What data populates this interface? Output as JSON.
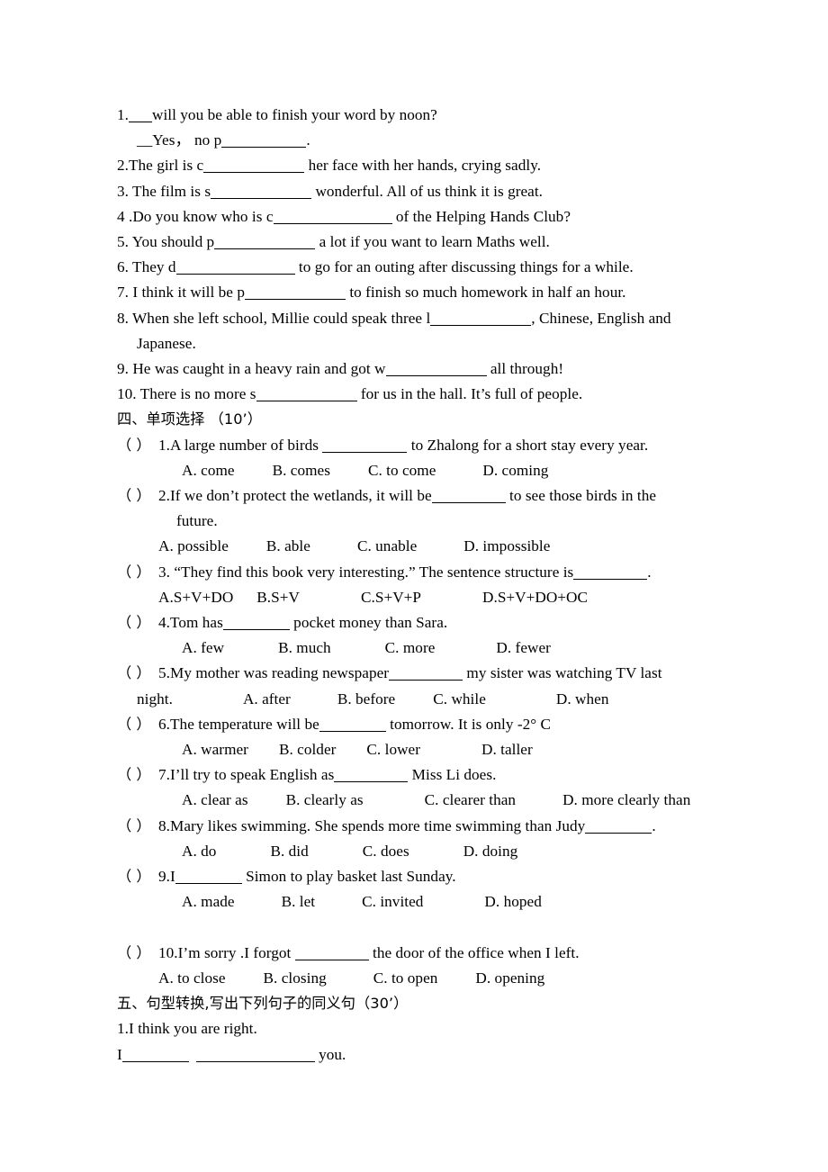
{
  "document": {
    "kind": "english-exam-worksheet-page"
  },
  "word_fill_section": {
    "items": [
      {
        "id": "q1",
        "lines": [
          {
            "pre": "1.",
            "blank": "tiny",
            "post": "will you be able to finish your word by noon?"
          },
          {
            "pre": "__Yes，  no p",
            "blank": "long",
            "post": "."
          }
        ]
      },
      {
        "id": "q2",
        "pre": "2.The girl is c",
        "blank": "xl",
        "post": " her face with her hands, crying sadly."
      },
      {
        "id": "q3",
        "pre": "3. The film is s",
        "blank": "xl",
        "post": " wonderful. All of us think it is great."
      },
      {
        "id": "q4",
        "pre": "4 .Do you know who is c",
        "blank": "xxl",
        "post": " of the Helping Hands Club?"
      },
      {
        "id": "q5",
        "pre": "5. You should p",
        "blank": "xl",
        "post": " a lot if you want to learn Maths well."
      },
      {
        "id": "q6",
        "pre": "6. They d",
        "blank": "xxl",
        "post": " to go for an outing after discussing things for a while."
      },
      {
        "id": "q7",
        "pre": "7. I think it will be p",
        "blank": "xl",
        "post": " to finish so much homework in half an hour."
      },
      {
        "id": "q8",
        "pre": "8. When she left school, Millie could speak three l",
        "blank": "xl",
        "post": ", Chinese, English and",
        "cont": "Japanese."
      },
      {
        "id": "q9",
        "pre": "9. He was caught in a heavy rain and got w",
        "blank": "xl",
        "post": " all through!"
      },
      {
        "id": "q10",
        "pre": "10. There is no more s",
        "blank": "xl",
        "post": " for us in the hall. It’s full of people."
      }
    ]
  },
  "multiple_choice_section": {
    "heading": "四、单项选择 （10’）",
    "paren": "（    ）",
    "questions": [
      {
        "number": "1.",
        "stem_pre": "A large number of birds ",
        "blank": "long",
        "stem_post": " to Zhalong for a short stay every year.",
        "options": [
          "A. come",
          "B. comes",
          "C. to come",
          "D. coming"
        ]
      },
      {
        "number": "2.",
        "stem_pre": "If we don’t protect the wetlands, it will be",
        "blank": "m2",
        "stem_post": " to see those birds in the",
        "stem_cont": "future.",
        "options": [
          "A. possible",
          "B. able",
          "C. unable",
          "D. impossible"
        ]
      },
      {
        "number": "3.",
        "stem_pre": " “They find this book very interesting.”   The sentence structure is",
        "blank": "m2",
        "stem_post": ".",
        "options": [
          "A.S+V+DO",
          "B.S+V",
          "C.S+V+P",
          "D.S+V+DO+OC"
        ]
      },
      {
        "number": "4.",
        "stem_pre": "Tom has",
        "blank": "med",
        "stem_post": " pocket money than Sara.",
        "options": [
          "A. few",
          "B. much",
          "C. more",
          "D. fewer"
        ]
      },
      {
        "number": "5.",
        "stem_pre": "My mother was reading newspaper",
        "blank": "m2",
        "stem_post": " my sister was watching TV last",
        "stem_cont": "night.",
        "options": [
          "A. after",
          "B. before",
          "C. while",
          "D. when"
        ],
        "options_inline_with_cont": true
      },
      {
        "number": "6.",
        "stem_pre": "The temperature will be",
        "blank": "med",
        "stem_post": " tomorrow. It is only -2°  C",
        "options": [
          "A. warmer",
          "B. colder",
          "C. lower",
          "D. taller"
        ]
      },
      {
        "number": "7.",
        "stem_pre": "I’ll try to speak English as",
        "blank": "m2",
        "stem_post": " Miss Li does.",
        "options": [
          "A. clear as",
          "B. clearly as",
          "C. clearer than",
          "D. more clearly than"
        ]
      },
      {
        "number": "8.",
        "stem_pre": "Mary likes swimming. She spends more time swimming than Judy",
        "blank": "med",
        "stem_post": ".",
        "options": [
          "A. do",
          "B. did",
          "C. does",
          "D. doing"
        ]
      },
      {
        "number": "9.",
        "stem_pre": "I",
        "blank": "med",
        "stem_post": " Simon to play basket last Sunday.",
        "options": [
          "A. made",
          "B. let",
          "C. invited",
          "D. hoped"
        ]
      },
      {
        "number": "10.",
        "stem_pre": "I’m sorry .I forgot ",
        "blank": "m2",
        "stem_post": " the door of the office when I left.",
        "options": [
          "A. to close",
          "B. closing",
          "C. to open",
          "D. opening"
        ]
      }
    ]
  },
  "transformation_section": {
    "heading": "五、句型转换,写出下列句子的同义句（30’）",
    "items": [
      {
        "prompt": "1.I think you are right.",
        "answer_pre": "I",
        "answer_blank1": "med",
        "answer_blank2": "xxl",
        "answer_post": " you."
      }
    ]
  }
}
